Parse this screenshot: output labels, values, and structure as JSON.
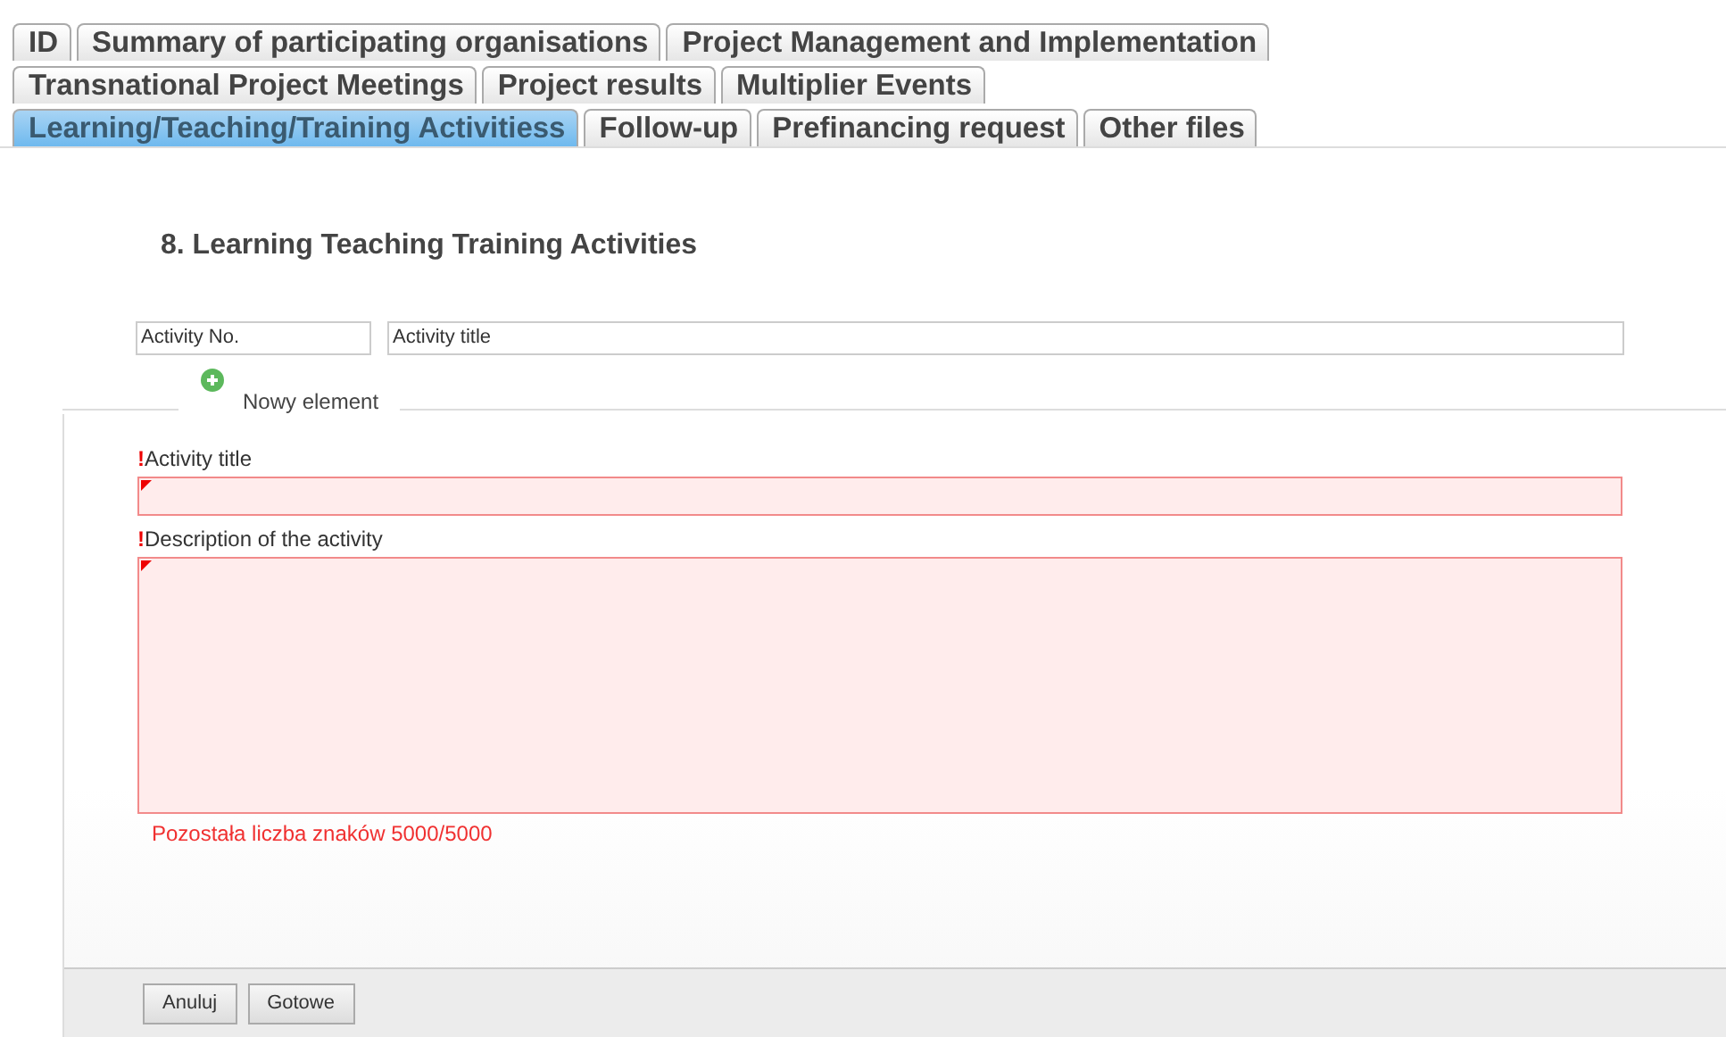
{
  "tab_rows": [
    [
      {
        "label": "ID",
        "selected": false
      },
      {
        "label": "Summary of participating organisations",
        "selected": false
      },
      {
        "label": "Project Management and Implementation",
        "selected": false
      }
    ],
    [
      {
        "label": "Transnational Project Meetings",
        "selected": false
      },
      {
        "label": "Project results",
        "selected": false
      },
      {
        "label": "Multiplier Events",
        "selected": false
      }
    ],
    [
      {
        "label": "Learning/Teaching/Training Activitiess",
        "selected": true
      },
      {
        "label": "Follow-up",
        "selected": false
      },
      {
        "label": "Prefinancing request",
        "selected": false
      },
      {
        "label": "Other files",
        "selected": false
      }
    ]
  ],
  "heading": "8. Learning Teaching Training Activities",
  "columns": [
    "Activity No.",
    "Activity title"
  ],
  "new_element": {
    "legend": "Nowy element",
    "fields": [
      {
        "kind": "line",
        "mark": "!",
        "label": "Activity title",
        "invalid": true
      },
      {
        "kind": "area",
        "mark": "!",
        "label": "Description of the activity",
        "invalid": true,
        "counter": "Pozostała liczba znaków 5000/5000"
      }
    ],
    "buttons": [
      "Anuluj",
      "Gotowe"
    ]
  }
}
